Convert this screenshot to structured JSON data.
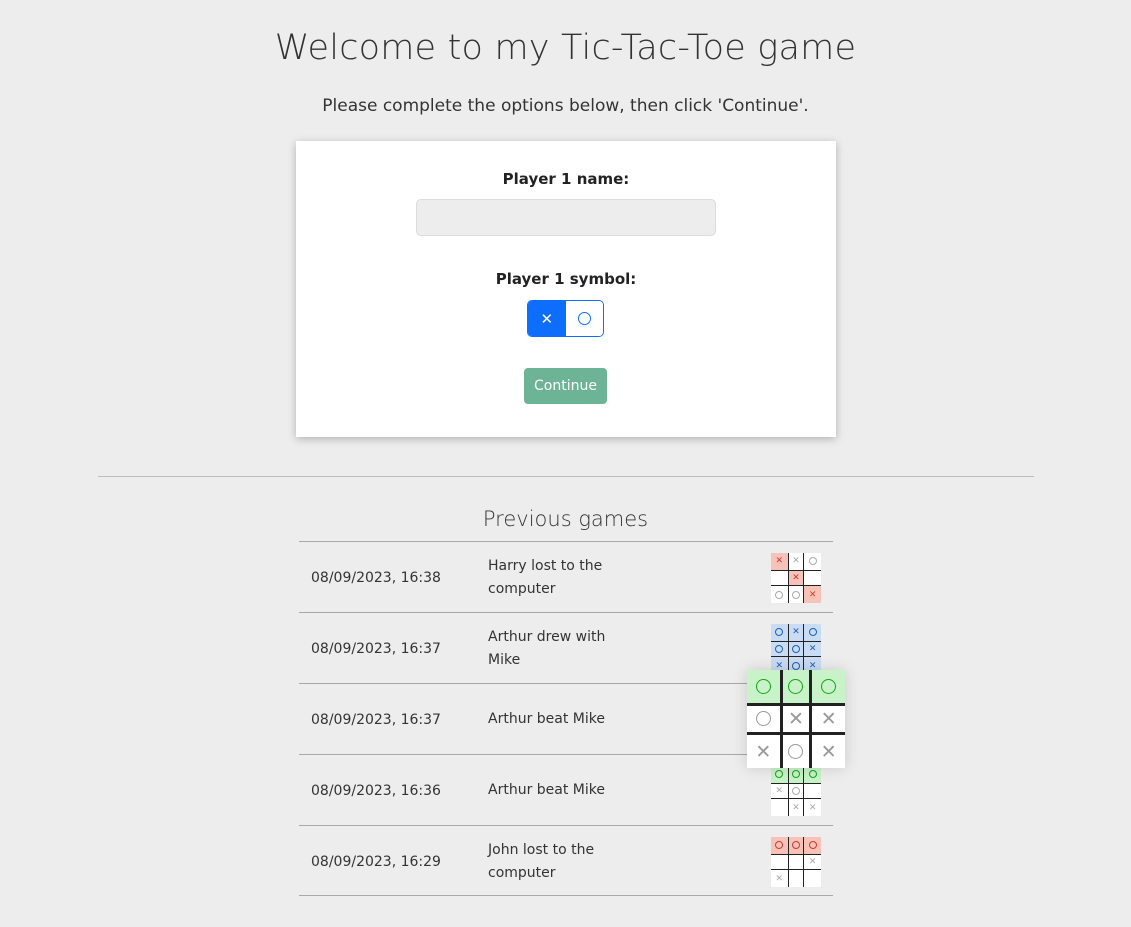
{
  "page": {
    "title": "Welcome to my Tic-Tac-Toe game",
    "subtitle": "Please complete the options below, then click 'Continue'."
  },
  "options": {
    "player_name_label": "Player 1 name:",
    "player_name_value": "",
    "player_name_placeholder": "",
    "symbol_label": "Player 1 symbol:",
    "symbols": [
      {
        "glyph": "✕",
        "name": "x",
        "selected": true
      },
      {
        "glyph": "○",
        "name": "o",
        "selected": false
      }
    ],
    "continue_label": "Continue"
  },
  "history": {
    "title": "Previous games",
    "games": [
      {
        "date": "08/09/2023, 16:38",
        "result": "Harry lost to the computer",
        "outcome": "lose",
        "board": [
          "X",
          "X",
          "O",
          "",
          "X",
          "",
          "O",
          "O",
          "X"
        ],
        "winning_cells": [
          0,
          4,
          8
        ]
      },
      {
        "date": "08/09/2023, 16:37",
        "result": "Arthur drew with Mike",
        "outcome": "draw",
        "board": [
          "O",
          "X",
          "O",
          "O",
          "O",
          "X",
          "X",
          "O",
          "X"
        ],
        "winning_cells": [
          0,
          1,
          2,
          3,
          4,
          5,
          6,
          7,
          8
        ]
      },
      {
        "date": "08/09/2023, 16:37",
        "result": "Arthur beat Mike",
        "outcome": "beat",
        "board": [
          "O",
          "O",
          "O",
          "O",
          "X",
          "X",
          "X",
          "O",
          "X"
        ],
        "winning_cells": [
          0,
          1,
          2
        ]
      },
      {
        "date": "08/09/2023, 16:36",
        "result": "Arthur beat Mike",
        "outcome": "beat",
        "board": [
          "O",
          "O",
          "O",
          "X",
          "O",
          "",
          "",
          "X",
          "X"
        ],
        "winning_cells": [
          0,
          1,
          2
        ]
      },
      {
        "date": "08/09/2023, 16:29",
        "result": "John lost to the computer",
        "outcome": "lose",
        "board": [
          "O",
          "O",
          "O",
          "",
          "",
          "X",
          "X",
          "",
          ""
        ],
        "winning_cells": [
          0,
          1,
          2
        ]
      }
    ],
    "zoomed_game_index": 2
  },
  "colors": {
    "primary": "#0d6efd",
    "continue_button": "#6db396",
    "lose_highlight": "#f7c3b8",
    "draw_highlight": "#c9dcf4",
    "win_highlight": "#c8f3c8"
  }
}
